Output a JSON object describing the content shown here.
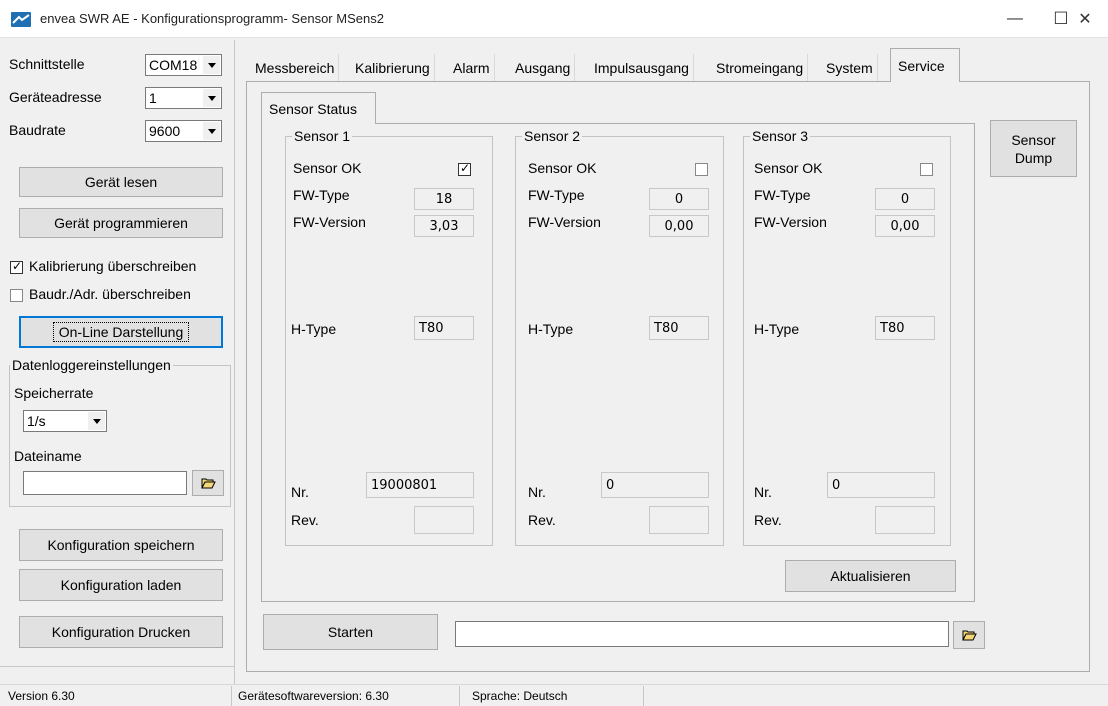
{
  "window": {
    "title": "envea SWR AE - Konfigurationsprogramm- Sensor MSens2",
    "minimize": "—",
    "maximize": "☐",
    "close": "✕"
  },
  "left": {
    "interface_label": "Schnittstelle",
    "interface_value": "COM18",
    "address_label": "Geräteadresse",
    "address_value": "1",
    "baud_label": "Baudrate",
    "baud_value": "9600",
    "read_button": "Gerät lesen",
    "program_button": "Gerät programmieren",
    "overwrite_calibration": "Kalibrierung überschreiben",
    "overwrite_calibration_checked": true,
    "overwrite_baud": "Baudr./Adr. überschreiben",
    "overwrite_baud_checked": false,
    "online_button": "On-Line Darstellung",
    "datalogger": {
      "title": "Datenloggereinstellungen",
      "rate_label": "Speicherrate",
      "rate_value": "1/s",
      "filename_label": "Dateiname",
      "filename_value": ""
    },
    "save_config": "Konfiguration speichern",
    "load_config": "Konfiguration laden",
    "print_config": "Konfiguration Drucken"
  },
  "tabs": [
    "Messbereich",
    "Kalibrierung",
    "Alarm",
    "Ausgang",
    "Impulsausgang",
    "Stromeingang",
    "System",
    "Service"
  ],
  "active_tab": "Service",
  "service": {
    "subtab": "Sensor Status",
    "sensor_dump": "Sensor\nDump",
    "update_button": "Aktualisieren",
    "start_button": "Starten",
    "path_value": "",
    "labels": {
      "ok": "Sensor OK",
      "fw_type": "FW-Type",
      "fw_version": "FW-Version",
      "h_type": "H-Type",
      "nr": "Nr.",
      "rev": "Rev."
    },
    "sensors": [
      {
        "name": "Sensor 1",
        "ok": true,
        "fw_type": "18",
        "fw_version": "3,03",
        "h_type": "T80",
        "nr": "19000801",
        "rev": ""
      },
      {
        "name": "Sensor 2",
        "ok": false,
        "fw_type": "0",
        "fw_version": "0,00",
        "h_type": "T80",
        "nr": "0",
        "rev": ""
      },
      {
        "name": "Sensor 3",
        "ok": false,
        "fw_type": "0",
        "fw_version": "0,00",
        "h_type": "T80",
        "nr": "0",
        "rev": ""
      }
    ]
  },
  "status": {
    "version": "Version 6.30",
    "fw_version": "Gerätesoftwareversion: 6.30",
    "language": "Sprache: Deutsch"
  }
}
